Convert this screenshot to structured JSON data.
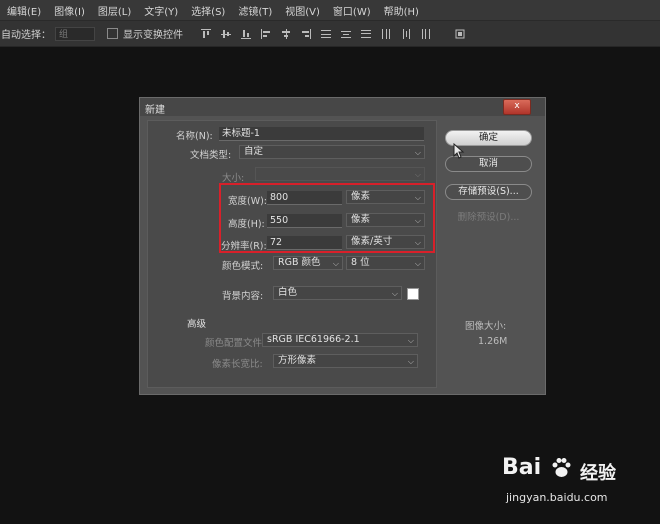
{
  "menubar": {
    "items": [
      "编辑(E)",
      "图像(I)",
      "图层(L)",
      "文字(Y)",
      "选择(S)",
      "滤镜(T)",
      "视图(V)",
      "窗口(W)",
      "帮助(H)"
    ]
  },
  "options": {
    "auto_select_label": "自动选择：",
    "auto_select_value": "组",
    "show_transform_label": "显示变换控件"
  },
  "dialog": {
    "title": "新建",
    "close_label": "x",
    "name_label": "名称(N):",
    "name_value": "未标题-1",
    "preset_label": "文档类型:",
    "preset_value": "自定",
    "size_label": "大小:",
    "size_value": "",
    "width_label": "宽度(W):",
    "width_value": "800",
    "width_unit": "像素",
    "height_label": "高度(H):",
    "height_value": "550",
    "height_unit": "像素",
    "resolution_label": "分辨率(R):",
    "resolution_value": "72",
    "resolution_unit": "像素/英寸",
    "color_mode_label": "颜色模式:",
    "color_mode_value": "RGB 颜色",
    "bit_depth_value": "8 位",
    "background_label": "背景内容:",
    "background_value": "白色",
    "advanced_label": "高级",
    "color_profile_label": "颜色配置文件:",
    "color_profile_value": "sRGB IEC61966-2.1",
    "pixel_aspect_label": "像素长宽比:",
    "pixel_aspect_value": "方形像素",
    "ok_label": "确定",
    "cancel_label": "取消",
    "save_preset_label": "存储预设(S)...",
    "delete_preset_label": "删除预设(D)...",
    "image_size_label": "图像大小:",
    "image_size_value": "1.26M"
  },
  "watermark": {
    "brand": "Bai",
    "brand_suffix": "经验",
    "url": "jingyan.baidu.com"
  },
  "colors": {
    "highlight": "#d8202a",
    "dialog_bg": "#535353",
    "menubar_bg": "#383838"
  }
}
